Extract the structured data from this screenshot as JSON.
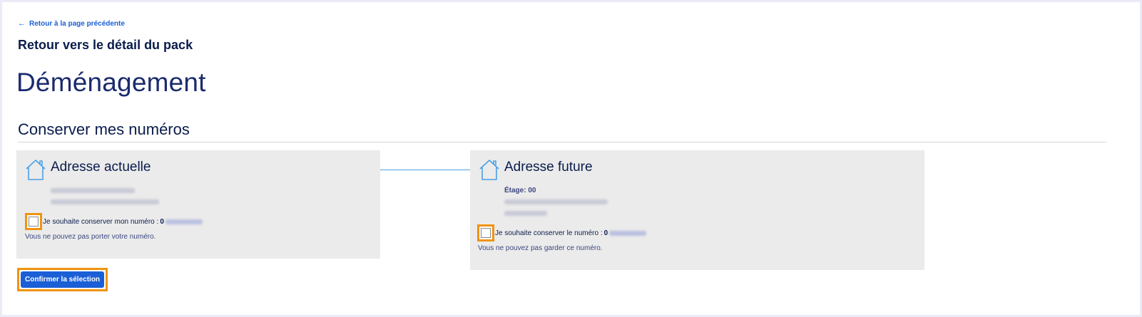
{
  "nav": {
    "back_arrow": "←",
    "back_label": "Retour à la page précédente",
    "back_pack_label": "Retour vers le détail du pack"
  },
  "page": {
    "title": "Déménagement",
    "section_title": "Conserver mes numéros"
  },
  "current_address": {
    "title": "Adresse actuelle",
    "icon": "house-icon",
    "checkbox_label": "Je souhaite conserver mon numéro :",
    "number_prefix": "0",
    "checked": false,
    "warning": "Vous ne pouvez pas porter votre numéro."
  },
  "future_address": {
    "title": "Adresse future",
    "icon": "house-icon",
    "floor": "Étage: 00",
    "checkbox_label": "Je souhaite conserver le numéro :",
    "number_prefix": "0",
    "checked": false,
    "warning": "Vous ne pouvez pas garder ce numéro."
  },
  "actions": {
    "confirm_label": "Confirmer la sélection"
  },
  "colors": {
    "accent": "#1a5fd6",
    "highlight": "#f0930f",
    "card_bg": "#ebebeb",
    "text_dark": "#0a1c4c",
    "icon": "#4aa0e8"
  }
}
